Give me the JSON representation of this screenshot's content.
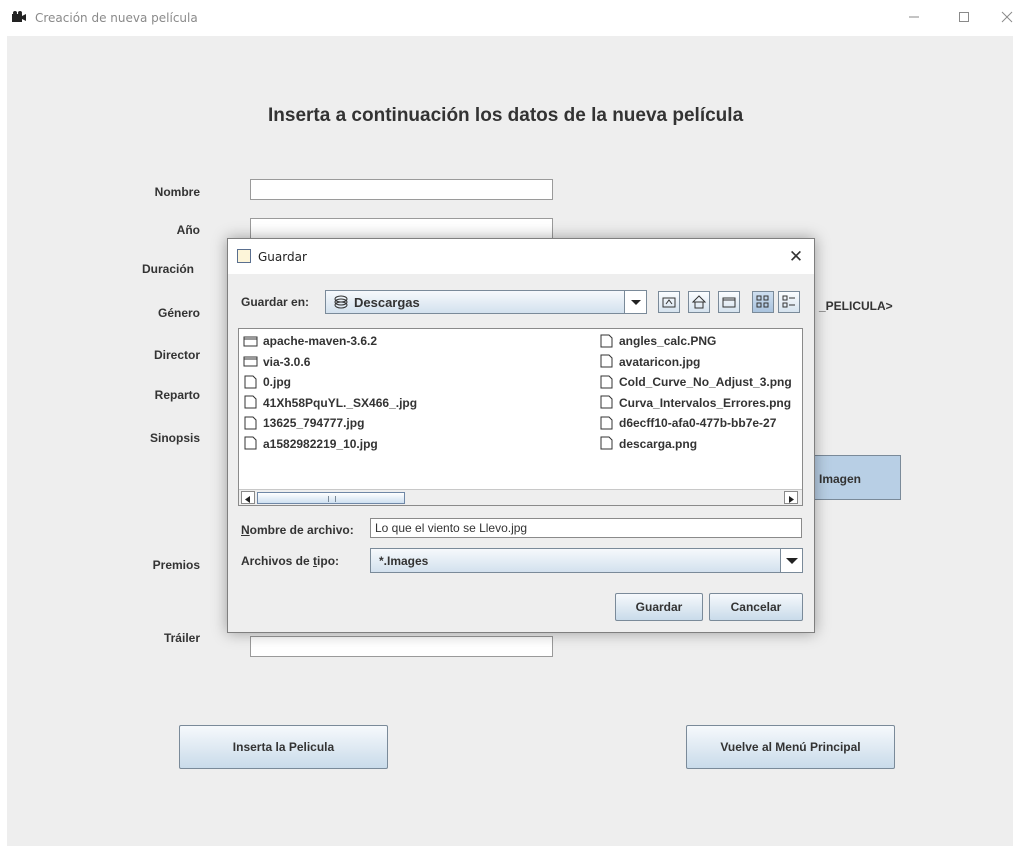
{
  "window": {
    "title": "Creación de nueva película",
    "minimize_icon": "minimize-icon",
    "maximize_icon": "maximize-icon",
    "close_icon": "close-icon"
  },
  "form": {
    "heading": "Inserta a continuación los datos de la nueva película",
    "labels": {
      "nombre": "Nombre",
      "anio": "Año",
      "duracion": "Duración",
      "genero": "Género",
      "director": "Director",
      "reparto": "Reparto",
      "sinopsis": "Sinopsis",
      "premios": "Premios",
      "trailer": "Tráiler"
    },
    "image_placeholder_text": "_PELICULA>",
    "image_button_label": "Imagen",
    "insert_button_label": "Inserta la Pelicula",
    "back_button_label": "Vuelve al Menú Principal"
  },
  "dialog": {
    "title": "Guardar",
    "save_in_label": "Guardar en:",
    "save_in_value": "Descargas",
    "toolbar_icons": [
      "up-folder-icon",
      "home-icon",
      "new-folder-icon",
      "list-view-icon",
      "details-view-icon"
    ],
    "files_col1": [
      {
        "name": "apache-maven-3.6.2",
        "type": "folder"
      },
      {
        "name": "via-3.0.6",
        "type": "folder"
      },
      {
        "name": "0.jpg",
        "type": "file"
      },
      {
        "name": "41Xh58PquYL._SX466_.jpg",
        "type": "file"
      },
      {
        "name": "13625_794777.jpg",
        "type": "file"
      },
      {
        "name": "a1582982219_10.jpg",
        "type": "file"
      }
    ],
    "files_col2": [
      {
        "name": "angles_calc.PNG",
        "type": "file"
      },
      {
        "name": "avataricon.jpg",
        "type": "file"
      },
      {
        "name": "Cold_Curve_No_Adjust_3.png",
        "type": "file"
      },
      {
        "name": "Curva_Intervalos_Errores.png",
        "type": "file"
      },
      {
        "name": "d6ecff10-afa0-477b-bb7e-27",
        "type": "file"
      },
      {
        "name": "descarga.png",
        "type": "file"
      }
    ],
    "filename_label_first": "N",
    "filename_label_rest": "ombre de archivo:",
    "filename_value": "Lo que el viento se Llevo.jpg",
    "filetype_label_pre": "Archivos de ",
    "filetype_label_u": "t",
    "filetype_label_post": "ipo:",
    "filetype_value": "*.Images",
    "save_button": "Guardar",
    "cancel_button": "Cancelar"
  }
}
